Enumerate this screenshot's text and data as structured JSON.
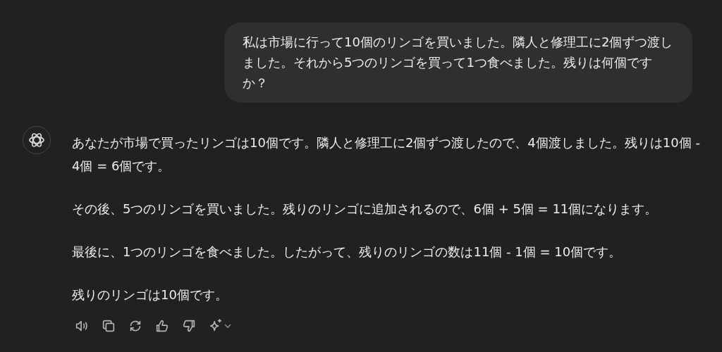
{
  "user_message": "私は市場に行って10個のリンゴを買いました。隣人と修理工に2個ずつ渡しました。それから5つのリンゴを買って1つ食べました。残りは何個ですか？",
  "assistant_message": {
    "paragraphs": [
      "あなたが市場で買ったリンゴは10個です。隣人と修理工に2個ずつ渡したので、4個渡しました。残りは10個 - 4個 = 6個です。",
      "その後、5つのリンゴを買いました。残りのリンゴに追加されるので、6個 + 5個 = 11個になります。",
      "最後に、1つのリンゴを食べました。したがって、残りのリンゴの数は11個 - 1個 = 10個です。",
      "残りのリンゴは10個です。"
    ],
    "actions": [
      {
        "kind": "speaker"
      },
      {
        "kind": "copy"
      },
      {
        "kind": "regenerate"
      },
      {
        "kind": "thumbs-up"
      },
      {
        "kind": "thumbs-down"
      },
      {
        "kind": "sparkle"
      }
    ]
  }
}
